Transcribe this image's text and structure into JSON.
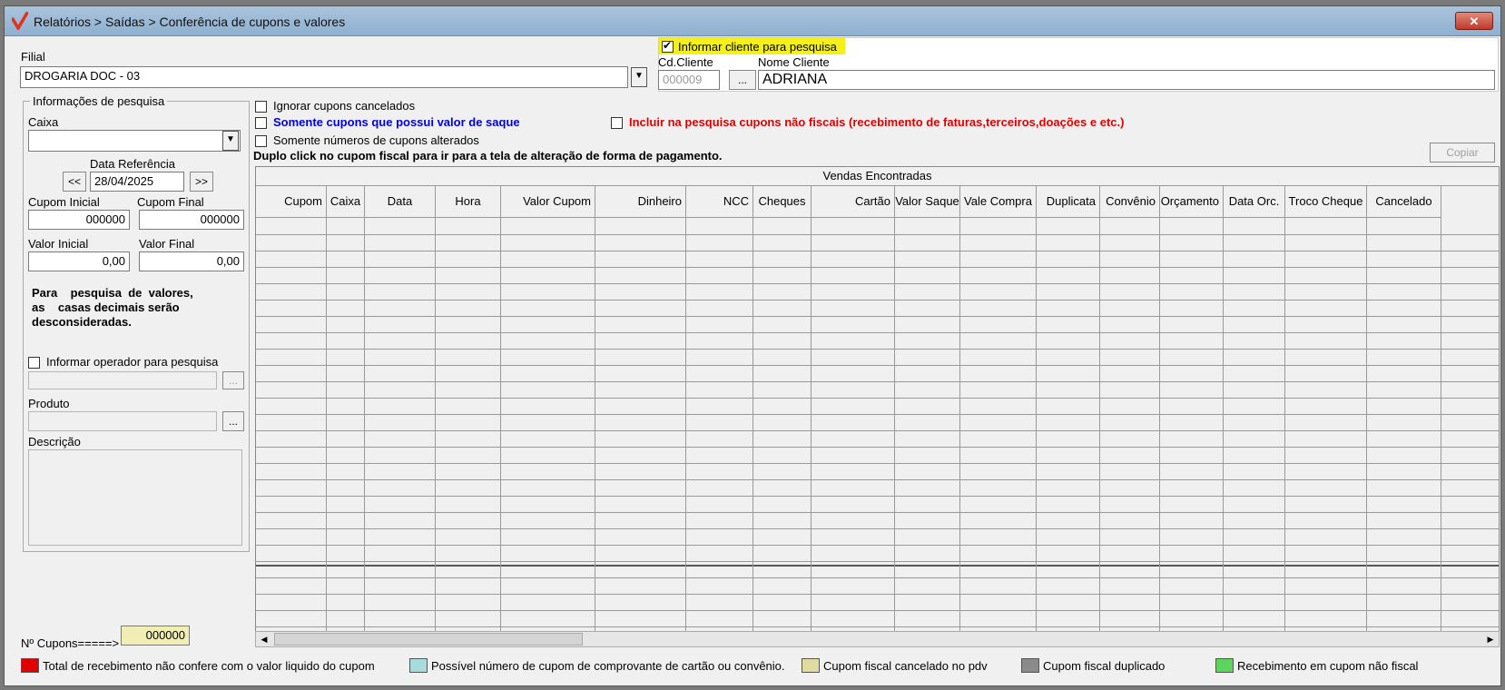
{
  "window": {
    "title": "Relatórios > Saídas > Conferência de cupons e valores",
    "close_label": "✕"
  },
  "filial": {
    "label": "Filial",
    "value": "DROGARIA DOC - 03"
  },
  "cliente": {
    "checkbox_label": "Informar cliente para pesquisa",
    "checked": true,
    "cd_label": "Cd.Cliente",
    "cd_value": "000009",
    "lookup_label": "...",
    "nome_label": "Nome Cliente",
    "nome_value": "ADRIANA"
  },
  "info": {
    "group_label": "Informações de pesquisa",
    "caixa_label": "Caixa",
    "caixa_value": "",
    "data_ref_label": "Data Referência",
    "prev_label": "<<",
    "next_label": ">>",
    "data_ref_value": "28/04/2025",
    "cupom_inicial_label": "Cupom Inicial",
    "cupom_inicial_value": "000000",
    "cupom_final_label": "Cupom Final",
    "cupom_final_value": "000000",
    "valor_inicial_label": "Valor Inicial",
    "valor_inicial_value": "0,00",
    "valor_final_label": "Valor Final",
    "valor_final_value": "0,00",
    "note_line1": "Para    pesquisa  de  valores,",
    "note_line2": "as    casas decimais serão",
    "note_line3": "desconsideradas.",
    "operador_label": "Informar operador para pesquisa",
    "operador_lookup": "...",
    "produto_label": "Produto",
    "produto_lookup": "...",
    "descricao_label": "Descrição"
  },
  "options": {
    "ignorar_cancelados": "Ignorar cupons cancelados",
    "somente_saque": "Somente cupons que possui valor de saque",
    "somente_alterados": "Somente números de cupons alterados",
    "incluir_nao_fiscais": "Incluir na pesquisa cupons não fiscais (recebimento de faturas,terceiros,doações  e etc.)",
    "hint": "Duplo click no cupom fiscal para ir para a tela de alteração de forma de pagamento.",
    "copiar_label": "Copiar"
  },
  "grid": {
    "title": "Vendas Encontradas",
    "columns": [
      "Cupom",
      "Caixa",
      "Data",
      "Hora",
      "Valor Cupom",
      "Dinheiro",
      "NCC",
      "Cheques",
      "Cartão",
      "Valor Saque",
      "Vale Compra",
      "Duplicata",
      "Convênio",
      "Orçamento",
      "Data Orc.",
      "Troco Cheque",
      "Cancelado"
    ],
    "rows": []
  },
  "footer": {
    "cupons_label": "Nº Cupons=====>",
    "cupons_value": "000000"
  },
  "legend": [
    {
      "color": "#e00000",
      "label": "Total de recebimento não confere com o valor liquido do cupom"
    },
    {
      "color": "#a8dcdc",
      "label": "Possível número de cupom de comprovante de cartão ou convênio."
    },
    {
      "color": "#e0dca0",
      "label": "Cupom fiscal cancelado no pdv"
    },
    {
      "color": "#8a8a8a",
      "label": "Cupom fiscal duplicado"
    },
    {
      "color": "#5ed45e",
      "label": "Recebimento em cupom não fiscal"
    }
  ]
}
